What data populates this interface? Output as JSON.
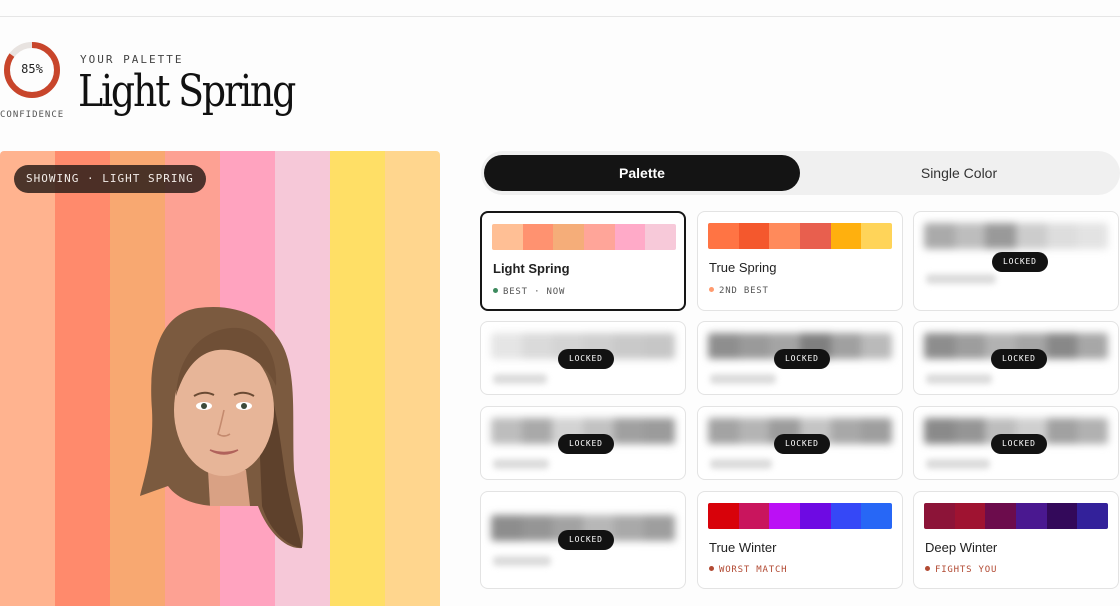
{
  "header": {
    "confidence_value": "85%",
    "confidence_fraction": 0.85,
    "confidence_label": "CONFIDENCE",
    "eyebrow": "YOUR PALETTE",
    "title": "Light Spring"
  },
  "preview": {
    "badge": "SHOWING · LIGHT SPRING",
    "stripes": [
      "#ffb38f",
      "#ff8a6c",
      "#f8a871",
      "#fda193",
      "#ffa3bf",
      "#f6c8d8",
      "#ffdf66",
      "#ffd68e"
    ]
  },
  "tabs": {
    "palette": "Palette",
    "single_color": "Single Color"
  },
  "cards": {
    "light_spring": {
      "name": "Light Spring",
      "tag": "BEST · NOW",
      "dot": "#3d8a5e",
      "swatches": [
        "#ffbf95",
        "#ff9270",
        "#f5ad79",
        "#ffa599",
        "#ffaac8",
        "#f7c9d9"
      ]
    },
    "true_spring": {
      "name": "True Spring",
      "tag": "2ND BEST",
      "dot": "#ff9a6e",
      "swatches": [
        "#ff7444",
        "#f4582d",
        "#ff8a5b",
        "#e85f4e",
        "#ffb00e",
        "#ffd459"
      ]
    },
    "true_winter": {
      "name": "True Winter",
      "tag": "WORST MATCH",
      "dot": "#b24a33",
      "swatches": [
        "#d8020a",
        "#c9155d",
        "#bb10f5",
        "#6e0ae3",
        "#3548f7",
        "#2767f6"
      ]
    },
    "deep_winter": {
      "name": "Deep Winter",
      "tag": "FIGHTS YOU",
      "dot": "#b24a33",
      "swatches": [
        "#8c1438",
        "#9f1331",
        "#6c0c4c",
        "#4a1890",
        "#33095a",
        "#33219a"
      ]
    },
    "locked_label": "LOCKED"
  }
}
